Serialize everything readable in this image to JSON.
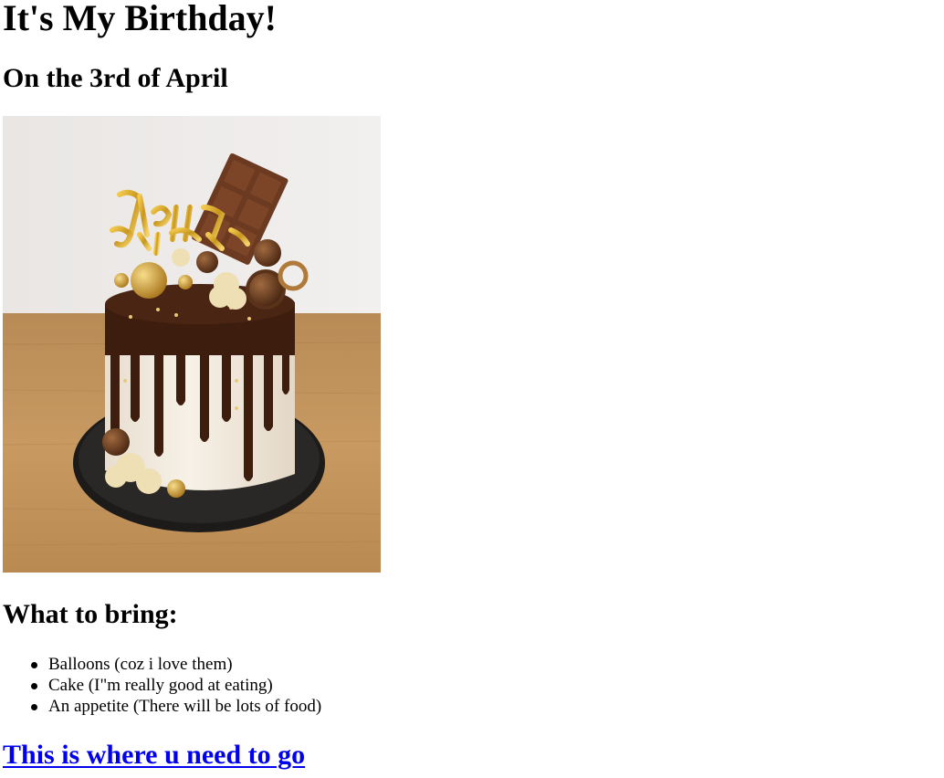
{
  "page": {
    "title": "It's My Birthday!",
    "subtitle": "On the 3rd of April",
    "image": {
      "alt": "cake",
      "description_icon": "birthday-cake-image",
      "topper_text": "Happy Birthday"
    },
    "bring_heading": "What to bring:",
    "bring_items": [
      "Balloons (coz i love them)",
      "Cake (I\"m really good at eating)",
      "An appetite (There will be lots of food)"
    ],
    "link_text": "This is where u need to go"
  },
  "colors": {
    "link": "#0000ee",
    "text": "#000000",
    "background": "#ffffff"
  }
}
